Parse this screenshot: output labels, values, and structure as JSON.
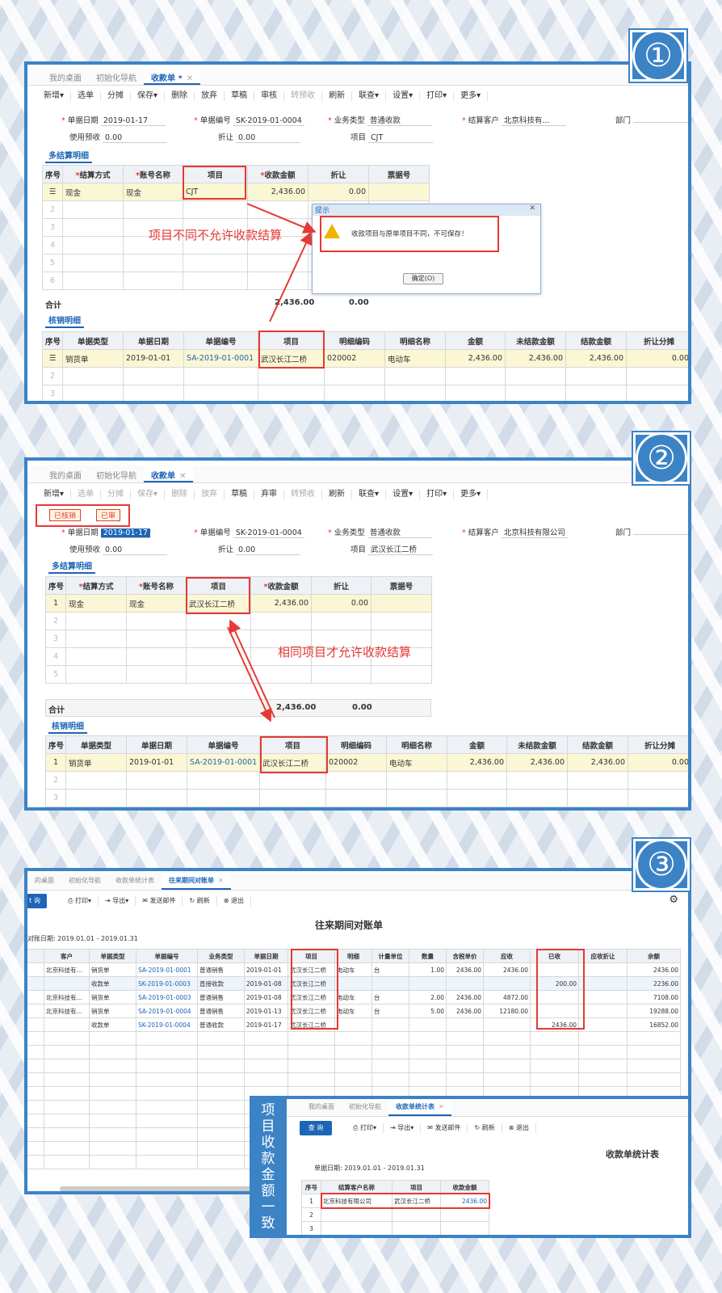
{
  "panel1": {
    "badge": "①",
    "tabs": [
      {
        "label": "我的桌面"
      },
      {
        "label": "初始化导航"
      },
      {
        "label": "收款单 *",
        "close": "✕"
      }
    ],
    "toolbar": [
      "新增▾",
      "选单",
      "分摊",
      "保存▾",
      "删除",
      "放弃",
      "草稿",
      "审核",
      "转预收",
      "刷新",
      "联查▾",
      "设置▾",
      "打印▾",
      "更多▾"
    ],
    "fields": {
      "date_label": "单据日期",
      "date": "2019-01-17",
      "no_label": "单据编号",
      "no": "SK-2019-01-0004",
      "type_label": "业务类型",
      "type": "普通收款",
      "cust_label": "结算客户",
      "cust": "北京科技有...",
      "dept_label": "部门",
      "prepay_label": "使用预收",
      "prepay": "0.00",
      "disc_label": "折让",
      "disc": "0.00",
      "proj_label": "项目",
      "proj": "CJT"
    },
    "sec1": "多结算明细",
    "t1_headers": [
      "序号",
      "结算方式",
      "账号名称",
      "项目",
      "收款金额",
      "折让",
      "票据号"
    ],
    "t1_rows": [
      [
        "",
        "现金",
        "现金",
        "CJT",
        "2,436.00",
        "0.00",
        ""
      ]
    ],
    "t1_empty": [
      "2",
      "3",
      "4",
      "5",
      "6"
    ],
    "total_label": "合计",
    "total_amt": "2,436.00",
    "total_disc": "0.00",
    "sec2": "核销明细",
    "t2_headers": [
      "序号",
      "单据类型",
      "单据日期",
      "单据编号",
      "项目",
      "明细编码",
      "明细名称",
      "金额",
      "未结款金额",
      "结款金额",
      "折让分摊"
    ],
    "t2_rows": [
      [
        "",
        "销货单",
        "2019-01-01",
        "SA-2019-01-0001",
        "武汉长江二桥",
        "020002",
        "电动车",
        "2,436.00",
        "2,436.00",
        "2,436.00",
        "0.00"
      ]
    ],
    "t2_empty": [
      "2",
      "3"
    ],
    "note": "项目不同不允许收款结算",
    "dialog": {
      "title": "提示",
      "msg": "收款项目与原单项目不同，不可保存！",
      "ok": "确定(O)",
      "close": "✕"
    }
  },
  "panel2": {
    "badge": "②",
    "tabs": [
      {
        "label": "我的桌面"
      },
      {
        "label": "初始化导航"
      },
      {
        "label": "收款单",
        "close": "✕"
      }
    ],
    "toolbar": [
      "新增▾",
      "选单",
      "分摊",
      "保存▾",
      "删除",
      "放弃",
      "草稿",
      "弃审",
      "转预收",
      "刷新",
      "联查▾",
      "设置▾",
      "打印▾",
      "更多▾"
    ],
    "stamps": [
      "已核销",
      "已审"
    ],
    "fields": {
      "date_label": "单据日期",
      "date": "2019-01-17",
      "no_label": "单据编号",
      "no": "SK-2019-01-0004",
      "type_label": "业务类型",
      "type": "普通收款",
      "cust_label": "结算客户",
      "cust": "北京科技有限公司",
      "dept_label": "部门",
      "prepay_label": "使用预收",
      "prepay": "0.00",
      "disc_label": "折让",
      "disc": "0.00",
      "proj_label": "项目",
      "proj": "武汉长江二桥"
    },
    "sec1": "多结算明细",
    "t1_headers": [
      "序号",
      "结算方式",
      "账号名称",
      "项目",
      "收款金额",
      "折让",
      "票据号"
    ],
    "t1_rows": [
      [
        "1",
        "现金",
        "现金",
        "武汉长江二桥",
        "2,436.00",
        "0.00",
        ""
      ]
    ],
    "t1_empty": [
      "2",
      "3",
      "4",
      "5"
    ],
    "total_label": "合计",
    "total_amt": "2,436.00",
    "total_disc": "0.00",
    "sec2": "核销明细",
    "t2_headers": [
      "序号",
      "单据类型",
      "单据日期",
      "单据编号",
      "项目",
      "明细编码",
      "明细名称",
      "金额",
      "未结款金额",
      "结款金额",
      "折让分摊"
    ],
    "t2_rows": [
      [
        "1",
        "销货单",
        "2019-01-01",
        "SA-2019-01-0001",
        "武汉长江二桥",
        "020002",
        "电动车",
        "2,436.00",
        "2,436.00",
        "2,436.00",
        "0.00"
      ]
    ],
    "t2_empty": [
      "2",
      "3"
    ],
    "note": "相同项目才允许收款结算"
  },
  "panel3": {
    "badge": "③",
    "tabs": [
      {
        "label": "的桌面"
      },
      {
        "label": "初始化导航"
      },
      {
        "label": "收款单统计表"
      },
      {
        "label": "往来期间对账单",
        "close": "✕"
      }
    ],
    "query": "t 询",
    "toolbar": [
      "打印▾",
      "导出▾",
      "发送邮件",
      "刷新",
      "退出"
    ],
    "title": "往来期间对账单",
    "period": "对账日期: 2019.01.01 - 2019.01.31",
    "headers": [
      "",
      "客户",
      "单据类型",
      "单据编号",
      "业务类型",
      "单据日期",
      "项目",
      "明细",
      "计量单位",
      "数量",
      "含税单价",
      "应收",
      "已收",
      "应收折让",
      "余额"
    ],
    "rows": [
      [
        "",
        "北京科技有...",
        "销货单",
        "SA-2019-01-0001",
        "普通销售",
        "2019-01-01",
        "武汉长江二桥",
        "电动车",
        "台",
        "1.00",
        "2436.00",
        "2436.00",
        "",
        "",
        "2436.00"
      ],
      [
        "",
        "",
        "收款单",
        "SK-2019-01-0003",
        "直接收款",
        "2019-01-08",
        "武汉长江二桥",
        "",
        "",
        "",
        "",
        "",
        "200.00",
        "",
        "2236.00"
      ],
      [
        "",
        "北京科技有...",
        "销货单",
        "SA-2019-01-0003",
        "普通销售",
        "2019-01-08",
        "武汉长江二桥",
        "电动车",
        "台",
        "2.00",
        "2436.00",
        "4872.00",
        "",
        "",
        "7108.00"
      ],
      [
        "",
        "北京科技有...",
        "销货单",
        "SA-2019-01-0004",
        "普通销售",
        "2019-01-13",
        "武汉长江二桥",
        "电动车",
        "台",
        "5.00",
        "2436.00",
        "12180.00",
        "",
        "",
        "19288.00"
      ],
      [
        "",
        "",
        "收款单",
        "SK-2019-01-0004",
        "普通收款",
        "2019-01-17",
        "武汉长江二桥",
        "",
        "",
        "",
        "",
        "",
        "2436.00",
        "",
        "16852.00"
      ]
    ],
    "side_note": "项目收款金额一致",
    "sub": {
      "tabs": [
        {
          "label": "我的桌面"
        },
        {
          "label": "初始化导航"
        },
        {
          "label": "收款单统计表",
          "close": "✕"
        }
      ],
      "query": "查 询",
      "toolbar": [
        "打印▾",
        "导出▾",
        "发送邮件",
        "刷新",
        "退出"
      ],
      "title": "收款单统计表",
      "period": "单据日期: 2019.01.01 - 2019.01.31",
      "headers": [
        "序号",
        "结算客户名称",
        "项目",
        "收款金额"
      ],
      "rows": [
        [
          "1",
          "北京科技有限公司",
          "武汉长江二桥",
          "2436.00"
        ]
      ],
      "empty": [
        "2",
        "3"
      ]
    }
  }
}
